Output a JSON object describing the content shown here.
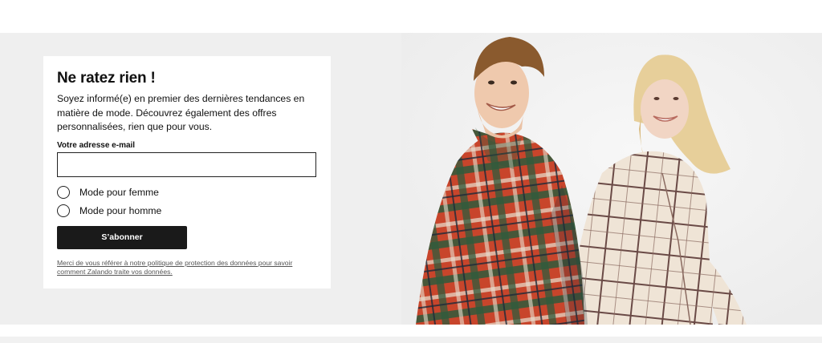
{
  "newsletter": {
    "title": "Ne ratez rien !",
    "intro": "Soyez informé(e) en premier des dernières tendances en matière de mode. Découvrez également des offres personnalisées, rien que pour vous.",
    "email_label": "Votre adresse e-mail",
    "email_value": "",
    "email_placeholder": "",
    "options": [
      {
        "label": "Mode pour femme",
        "selected": false
      },
      {
        "label": "Mode pour homme",
        "selected": false
      }
    ],
    "subscribe_label": "S’abonner",
    "privacy_text": "Merci de vous référer à notre politique de protection des données pour savoir comment Zalando traite vos données."
  },
  "colors": {
    "banner_bg": "#efefef",
    "button_bg": "#1a1a1a",
    "plaid_red": "#c8452b",
    "plaid_green": "#2f5a3c",
    "cream_jacket": "#efe4d6"
  },
  "hero_image": {
    "icon": "models-photo"
  }
}
